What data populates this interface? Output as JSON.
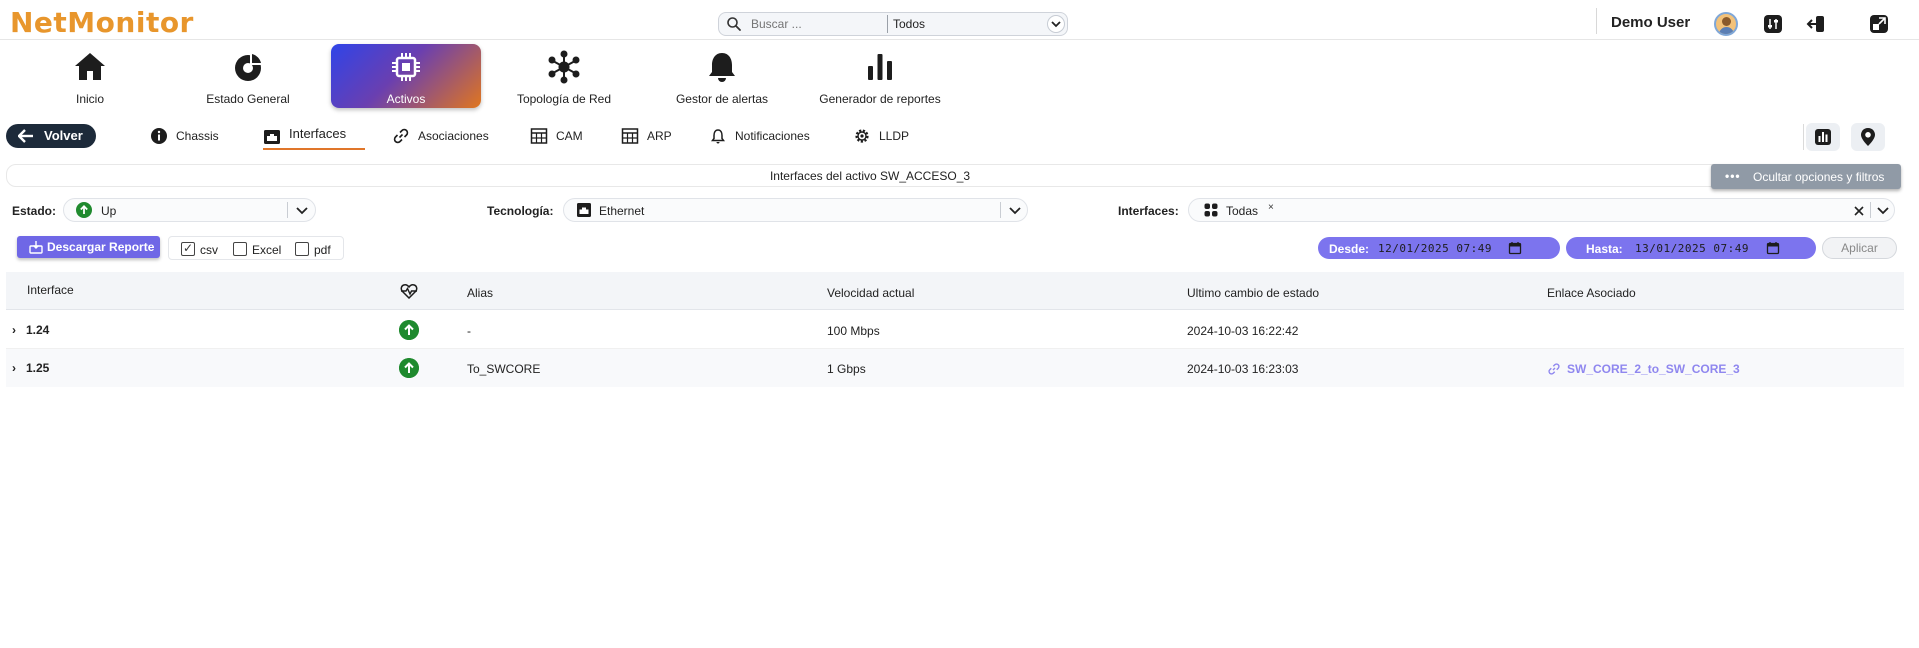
{
  "app": {
    "logo": "NetMonitor",
    "brand_color": "#e8962c",
    "accent_color": "#6f67e6"
  },
  "search": {
    "placeholder": "Buscar ...",
    "scope_value": "Todos"
  },
  "user": {
    "name": "Demo User"
  },
  "toolbar_icons": [
    "settings-sliders-icon",
    "logout-icon",
    "expand-icon"
  ],
  "main_nav": [
    {
      "label": "Inicio",
      "icon": "home-icon"
    },
    {
      "label": "Estado General",
      "icon": "pie-chart-icon"
    },
    {
      "label": "Activos",
      "icon": "chip-icon",
      "active": true
    },
    {
      "label": "Topología de Red",
      "icon": "network-topology-icon"
    },
    {
      "label": "Gestor de alertas",
      "icon": "bell-icon"
    },
    {
      "label": "Generador de reportes",
      "icon": "bar-chart-icon"
    }
  ],
  "sub_nav": {
    "back_label": "Volver",
    "tabs": [
      {
        "label": "Chassis",
        "icon": "info-icon"
      },
      {
        "label": "Interfaces",
        "icon": "ethernet-port-icon",
        "active": true
      },
      {
        "label": "Asociaciones",
        "icon": "link-icon"
      },
      {
        "label": "CAM",
        "icon": "table-icon"
      },
      {
        "label": "ARP",
        "icon": "table-icon"
      },
      {
        "label": "Notificaciones",
        "icon": "bell-icon"
      },
      {
        "label": "LLDP",
        "icon": "gear-icon"
      }
    ],
    "right_buttons": [
      "bar-chart-icon",
      "map-pin-icon"
    ]
  },
  "title_bar": {
    "text": "Interfaces del activo SW_ACCESO_3",
    "toggle_label": "Ocultar opciones y filtros"
  },
  "filters": {
    "estado": {
      "label": "Estado:",
      "value": "Up"
    },
    "tecnologia": {
      "label": "Tecnología:",
      "value": "Ethernet"
    },
    "interfaces": {
      "label": "Interfaces:",
      "value": "Todas",
      "tag_remove": "×"
    }
  },
  "report": {
    "download_label": "Descargar Reporte",
    "formats": [
      {
        "label": "csv",
        "checked": true
      },
      {
        "label": "Excel",
        "checked": false
      },
      {
        "label": "pdf",
        "checked": false
      }
    ],
    "desde_label": "Desde:",
    "desde_value": "12/01/2025 07:49",
    "hasta_label": "Hasta:",
    "hasta_value": "13/01/2025 07:49",
    "apply_label": "Aplicar"
  },
  "table": {
    "columns": [
      "Interface",
      "Alias",
      "Velocidad actual",
      "Ultimo cambio de estado",
      "Enlace Asociado"
    ],
    "status_column_icon": "heartbeat-icon",
    "rows": [
      {
        "interface": "1.24",
        "status": "up",
        "alias": "-",
        "speed": "100 Mbps",
        "last_change": "2024-10-03 16:22:42",
        "link": ""
      },
      {
        "interface": "1.25",
        "status": "up",
        "alias": "To_SWCORE",
        "speed": "1 Gbps",
        "last_change": "2024-10-03 16:23:03",
        "link": "SW_CORE_2_to_SW_CORE_3"
      }
    ]
  }
}
